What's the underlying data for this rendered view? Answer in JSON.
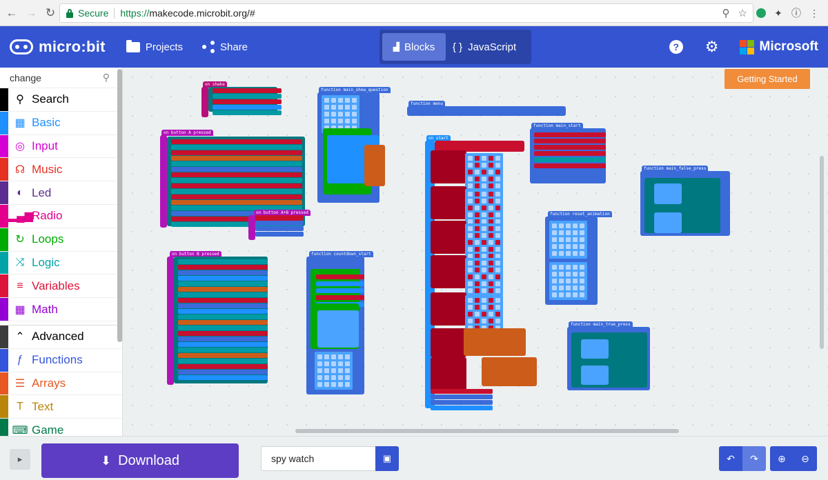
{
  "browser": {
    "secure_label": "Secure",
    "url_scheme": "https://",
    "url_rest": "makecode.microbit.org/#"
  },
  "header": {
    "logo_text": "micro:bit",
    "projects_label": "Projects",
    "share_label": "Share",
    "blocks_label": "Blocks",
    "javascript_label": "JavaScript",
    "microsoft_label": "Microsoft"
  },
  "toolbox": {
    "search_value": "change",
    "categories": [
      {
        "label": "Search",
        "color": "#000000",
        "icon": "search-icon"
      },
      {
        "label": "Basic",
        "color": "#1e90ff",
        "icon": "grid-icon"
      },
      {
        "label": "Input",
        "color": "#d400d4",
        "icon": "target-icon"
      },
      {
        "label": "Music",
        "color": "#e63022",
        "icon": "headphones-icon"
      },
      {
        "label": "Led",
        "color": "#5c2d91",
        "icon": "toggle-icon"
      },
      {
        "label": "Radio",
        "color": "#e3008c",
        "icon": "signal-icon"
      },
      {
        "label": "Loops",
        "color": "#00aa00",
        "icon": "loop-icon"
      },
      {
        "label": "Logic",
        "color": "#00a4a6",
        "icon": "shuffle-icon"
      },
      {
        "label": "Variables",
        "color": "#dc143c",
        "icon": "lines-icon"
      },
      {
        "label": "Math",
        "color": "#9400d3",
        "icon": "calculator-icon"
      }
    ],
    "advanced": [
      {
        "label": "Advanced",
        "color": "#3c3c3c",
        "icon": "chevron-up-icon"
      },
      {
        "label": "Functions",
        "color": "#3455db",
        "icon": "function-icon"
      },
      {
        "label": "Arrays",
        "color": "#e65722",
        "icon": "list-icon"
      },
      {
        "label": "Text",
        "color": "#b8860b",
        "icon": "text-icon"
      },
      {
        "label": "Game",
        "color": "#007a4b",
        "icon": "gamepad-icon"
      }
    ]
  },
  "workspace": {
    "getting_started_label": "Getting Started",
    "block_labels": {
      "on_shake": "on shake",
      "on_button_a": "on button A pressed",
      "on_button_ab": "on button A+B pressed",
      "on_button_b": "on button B pressed",
      "fn_main_show_question": "function main_show_question",
      "fn_menu": "function menu",
      "fn_main_start": "function main_start",
      "fn_main_false_press": "function main_false_press",
      "fn_countdown_start": "function countdown_start",
      "on_start": "on start",
      "fn_reset_animation": "function reset_animation",
      "fn_main_true_press": "function main_true_press"
    }
  },
  "bottom": {
    "download_label": "Download",
    "project_name": "spy watch"
  }
}
